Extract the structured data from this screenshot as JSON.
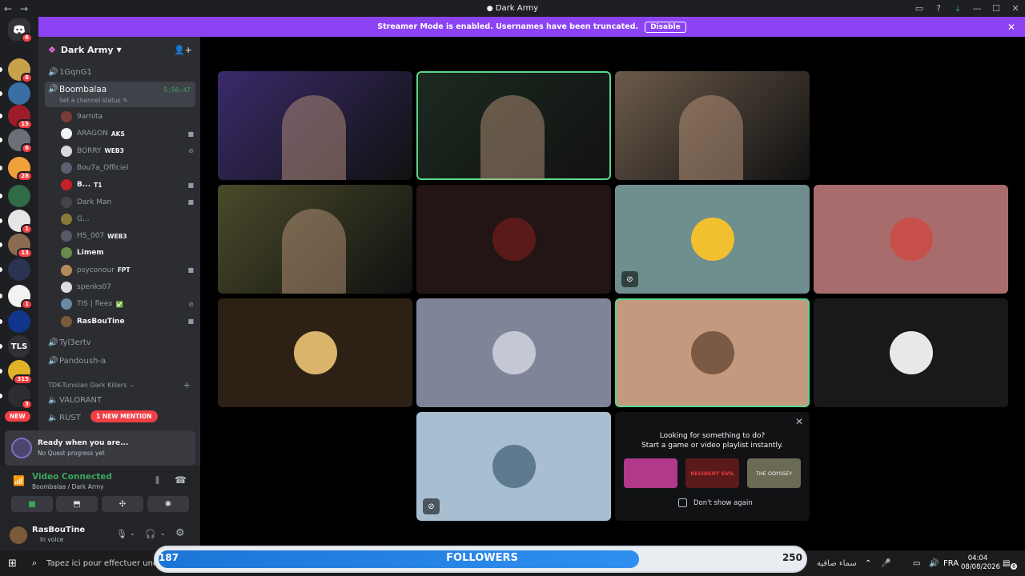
{
  "window": {
    "title": "Dark Army",
    "back": "←",
    "forward": "→"
  },
  "banner": {
    "text": "Streamer Mode is enabled. Usernames have been truncated.",
    "button": "Disable"
  },
  "rail": {
    "home_badge": "6",
    "servers": [
      {
        "badge": "6",
        "color": "#c7a24b"
      },
      {
        "badge": "",
        "color": "#3a6ea5"
      },
      {
        "badge": "15",
        "color": "#9c1c2a"
      },
      {
        "badge": "6",
        "color": "#6b6f78"
      },
      {
        "badge": "28",
        "color": "#f1a13a"
      },
      {
        "badge": "",
        "color": "#2f6b45"
      },
      {
        "badge": "1",
        "color": "#e5e5e5"
      },
      {
        "badge": "13",
        "color": "#8b6b4f"
      },
      {
        "badge": "",
        "color": "#2a3350"
      },
      {
        "badge": "1",
        "color": "#f2f2f2"
      },
      {
        "badge": "",
        "color": "#10358a"
      },
      {
        "badge": "",
        "color": "#2f3136",
        "label": "TLS"
      },
      {
        "badge": "315",
        "color": "#e0b229"
      },
      {
        "badge": "3",
        "color": "#2b2d31"
      }
    ],
    "new_label": "NEW"
  },
  "sidebar": {
    "server_name": "Dark Army",
    "channels_top": [
      "1GqnG1"
    ],
    "selected_channel": {
      "name": "Boombalaa",
      "status": "Set a channel status",
      "timer": "5:56:47"
    },
    "members": [
      {
        "name": "9arnita",
        "tag": "",
        "color": "#7a3b3b",
        "icon": ""
      },
      {
        "name": "ARAGON",
        "tag": "AKS",
        "color": "#f2f3f5",
        "icon": "video"
      },
      {
        "name": "BORRY",
        "tag": "WEB3",
        "color": "#d9d9d9",
        "icon": "mute"
      },
      {
        "name": "Bou7a_Officiel",
        "tag": "",
        "color": "#5a6270",
        "icon": ""
      },
      {
        "name": "B...",
        "tag": "T1",
        "color": "#c4202a",
        "icon": "video"
      },
      {
        "name": "Dark Man",
        "tag": "",
        "color": "#444",
        "icon": "video"
      },
      {
        "name": "G...",
        "tag": "",
        "color": "#8a7a3a",
        "icon": ""
      },
      {
        "name": "HS_007",
        "tag": "WEB3",
        "color": "#5a5a66",
        "icon": ""
      },
      {
        "name": "Limem",
        "tag": "",
        "color": "#6a8b4a",
        "icon": ""
      },
      {
        "name": "psyconour",
        "tag": "FPT",
        "color": "#b38a5a",
        "icon": "video"
      },
      {
        "name": "spenks07",
        "tag": "",
        "color": "#dcdcdc",
        "icon": ""
      },
      {
        "name": "TIS | fleex",
        "tag": "✅",
        "color": "#6b8aa3",
        "icon": "mute"
      },
      {
        "name": "RasBouTine",
        "tag": "",
        "color": "#7a5a3a",
        "icon": "video"
      }
    ],
    "channels_after": [
      "Tyl3ertv",
      "Pandoush-a"
    ],
    "category": "TDK-Tunisian Dark Killers",
    "category_channels": [
      "VALORANT",
      "RUST"
    ],
    "mention_badge": "1 NEW MENTION",
    "quest": {
      "title": "Ready when you are...",
      "subtitle": "No Quest progress yet"
    },
    "voice": {
      "status": "Video Connected",
      "location": "Boombalaa / Dark Army"
    },
    "user": {
      "name": "RasBouTine",
      "status": "In voice"
    }
  },
  "tiles": [
    {
      "kind": "video",
      "bg": "#3a2a6a",
      "speaking": false,
      "muted": false
    },
    {
      "kind": "video",
      "bg": "#1c2a20",
      "speaking": true,
      "muted": false
    },
    {
      "kind": "video",
      "bg": "#6b5a4a",
      "speaking": false,
      "muted": false
    },
    {
      "kind": "video",
      "bg": "#4a4a2a",
      "speaking": false,
      "muted": false
    },
    {
      "kind": "avatar",
      "bg": "#231416",
      "avatar": "#5a1a1a",
      "speaking": false,
      "muted": false
    },
    {
      "kind": "avatar",
      "bg": "#6e8f8e",
      "avatar": "#f2c02e",
      "speaking": false,
      "muted": true
    },
    {
      "kind": "avatar",
      "bg": "#a96c6c",
      "avatar": "#c7504a",
      "speaking": false,
      "muted": false
    },
    {
      "kind": "avatar",
      "bg": "#2c2114",
      "avatar": "#d9b46a",
      "speaking": false,
      "muted": false
    },
    {
      "kind": "avatar",
      "bg": "#7f8498",
      "avatar": "#c4c8d4",
      "speaking": false,
      "muted": false
    },
    {
      "kind": "avatar",
      "bg": "#c49a7f",
      "avatar": "#7a5a44",
      "speaking": true,
      "muted": false
    },
    {
      "kind": "avatar",
      "bg": "#191919",
      "avatar": "#e8e8e8",
      "speaking": false,
      "muted": false
    },
    {
      "kind": "avatar",
      "bg": "#a8bfd2",
      "avatar": "#5d7a8e",
      "speaking": false,
      "muted": true
    }
  ],
  "activity": {
    "title": "Looking for something to do?",
    "subtitle": "Start a game or video playlist instantly.",
    "dont_show": "Don't show again",
    "games": [
      {
        "color": "#b2388c"
      },
      {
        "color": "#5a1a1a",
        "label": "RESIDENT EVIL"
      },
      {
        "color": "#6b6b55",
        "label": "THE ODYSSEY"
      }
    ]
  },
  "followers": {
    "current": "187",
    "label": "FOLLOWERS",
    "goal": "250",
    "progress": 0.748
  },
  "taskbar": {
    "search": "Tapez ici pour effectuer une re",
    "weather": "سماء صافية",
    "lang": "FRA",
    "time": "04:04",
    "date": "08/08/2026",
    "notif": "6"
  }
}
